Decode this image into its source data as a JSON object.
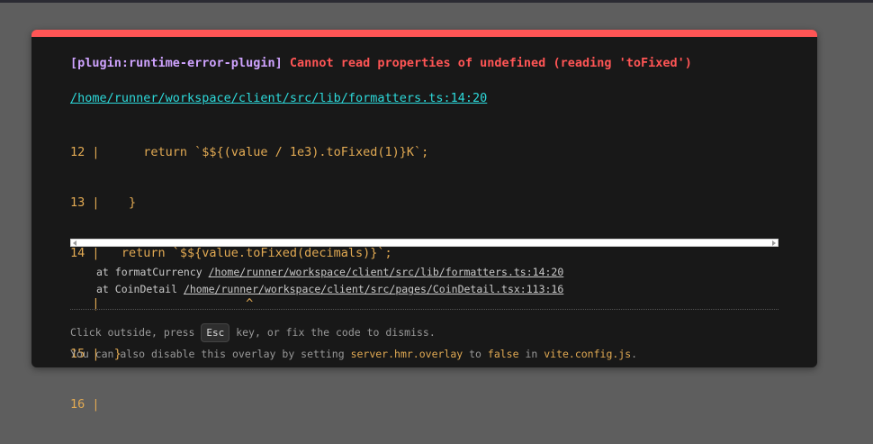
{
  "error": {
    "plugin": "[plugin:runtime-error-plugin]",
    "message": "Cannot read properties of undefined (reading 'toFixed')",
    "file": "/home/runner/workspace/client/src/lib/formatters.ts:14:20"
  },
  "code_frame": [
    "12 |      return `$${(value / 1e3).toFixed(1)}K`;",
    "13 |    }",
    "14 |   return `$${value.toFixed(decimals)}`;",
    "   |                    ^",
    "15 |  }",
    "16 |"
  ],
  "stack": [
    {
      "prefix": "at formatCurrency ",
      "location": "/home/runner/workspace/client/src/lib/formatters.ts:14:20"
    },
    {
      "prefix": "at CoinDetail ",
      "location": "/home/runner/workspace/client/src/pages/CoinDetail.tsx:113:16"
    }
  ],
  "tip": {
    "line1_pre": "Click outside, press ",
    "key": "Esc",
    "line1_post": " key, or fix the code to dismiss.",
    "line2_a": "You can also disable this overlay by setting ",
    "line2_setting": "server.hmr.overlay",
    "line2_b": " to ",
    "line2_value": "false",
    "line2_c": " in ",
    "line2_file": "vite.config.js",
    "line2_d": "."
  },
  "colors": {
    "accent_error": "#ff5555",
    "plugin": "#cfa3ff",
    "link": "#2dd9da",
    "code": "#e2aa53",
    "backdrop": "#5e5e5e",
    "panel": "#181818"
  }
}
